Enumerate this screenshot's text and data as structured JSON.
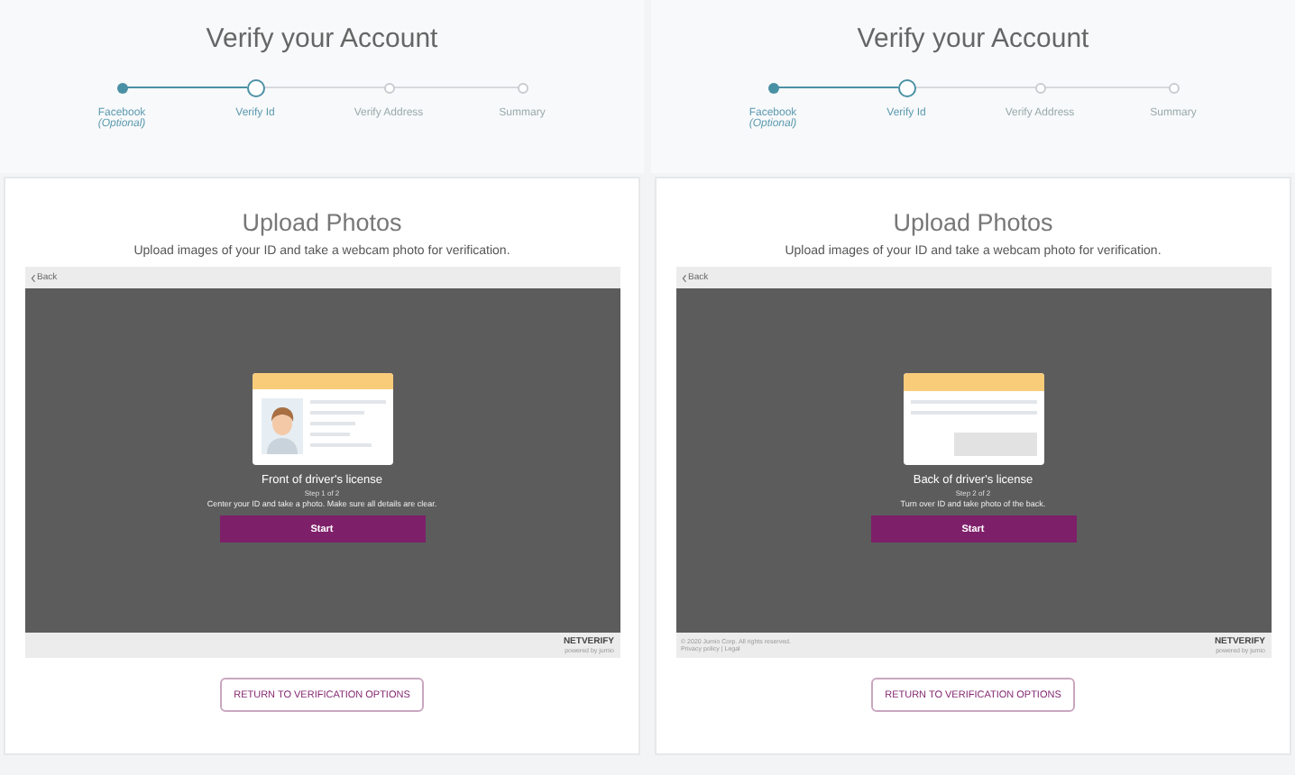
{
  "panels": [
    {
      "header": {
        "title": "Verify your Account",
        "steps": [
          {
            "label": "Facebook",
            "sublabel": "(Optional)",
            "completed": true,
            "selected": false
          },
          {
            "label": "Verify Id",
            "completed": false,
            "selected": true
          },
          {
            "label": "Verify Address",
            "completed": false,
            "selected": false
          },
          {
            "label": "Summary",
            "completed": false,
            "selected": false
          }
        ]
      },
      "card": {
        "title": "Upload Photos",
        "subtitle": "Upload images of your ID and take a webcam photo for verification.",
        "back": "Back",
        "kind": "front",
        "doc_title": "Front of driver's license",
        "step": "Step 1 of 2",
        "instruction": "Center your ID and take a photo. Make sure all details are clear.",
        "start": "Start",
        "brand": "NETVERIFY",
        "brand_sub": "powered by jumio",
        "return_button": "RETURN TO VERIFICATION OPTIONS"
      }
    },
    {
      "header": {
        "title": "Verify your Account",
        "steps": [
          {
            "label": "Facebook",
            "sublabel": "(Optional)",
            "completed": true,
            "selected": false
          },
          {
            "label": "Verify Id",
            "completed": false,
            "selected": true
          },
          {
            "label": "Verify Address",
            "completed": false,
            "selected": false
          },
          {
            "label": "Summary",
            "completed": false,
            "selected": false
          }
        ]
      },
      "card": {
        "title": "Upload Photos",
        "subtitle": "Upload images of your ID and take a webcam photo for verification.",
        "back": "Back",
        "kind": "back",
        "doc_title": "Back of driver's license",
        "step": "Step 2 of 2",
        "instruction": "Turn over ID and take photo of the back.",
        "start": "Start",
        "footer_lines": [
          "© 2020 Jumio Corp. All rights reserved.",
          "Privacy policy | Legal"
        ],
        "brand": "NETVERIFY",
        "brand_sub": "powered by jumio",
        "return_button": "RETURN TO VERIFICATION OPTIONS"
      }
    }
  ]
}
